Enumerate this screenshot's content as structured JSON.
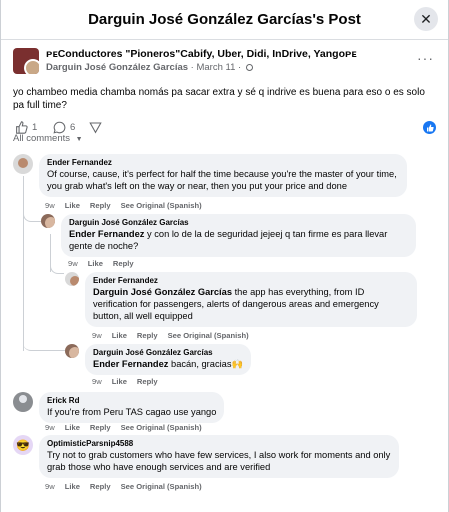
{
  "dialog": {
    "title": "Darguin José González Garcías's Post",
    "close_icon": "close-icon"
  },
  "post": {
    "group_name": "ᴘᴇConductores \"Pioneros\"Cabify, Uber, Didi, InDrive, Yangoᴘᴇ",
    "author": "Darguin José González Garcías",
    "date": "March 11",
    "separator": "·",
    "text": "yo chambeo media chamba nomás pa sacar extra y sé q indrive es buena para eso o es solo pa full time?",
    "like_count": "1",
    "comment_count": "6",
    "more_label": "···"
  },
  "comments_filter": "All comments",
  "comments": [
    {
      "name": "Ender Fernandez",
      "text": "Of course, cause, it's perfect for half the time because you're the master of your time, you grab what's left on the way or near, then you put your price and done",
      "time": "9w",
      "like": "Like",
      "reply": "Reply",
      "see_original": "See Original (Spanish)"
    },
    {
      "name": "Darguin José González Garcías",
      "mention": "Ender Fernandez",
      "text": " y con lo de la de seguridad jejeej q tan firme es para llevar gente de noche?",
      "time": "9w",
      "like": "Like",
      "reply": "Reply"
    },
    {
      "name": "Ender Fernandez",
      "mention": "Darguin José González Garcías",
      "text": " the app has everything, from ID verification for passengers, alerts of dangerous areas and emergency button, all well equipped",
      "time": "9w",
      "like": "Like",
      "reply": "Reply",
      "see_original": "See Original (Spanish)"
    },
    {
      "name": "Darguin José González Garcías",
      "mention": "Ender Fernandez",
      "text": " bacán, gracias🙌",
      "time": "9w",
      "like": "Like",
      "reply": "Reply"
    },
    {
      "name": "Erick Rd",
      "text": "If you're from Peru TAS cagao use yango",
      "time": "9w",
      "like": "Like",
      "reply": "Reply",
      "see_original": "See Original (Spanish)"
    },
    {
      "name": "OptimisticParsnip4588",
      "text": "Try not to grab customers who have few services, I also work for moments and only grab those who have enough services and are verified",
      "time": "9w",
      "like": "Like",
      "reply": "Reply",
      "see_original": "See Original (Spanish)"
    }
  ],
  "colors": {
    "accent": "#1877f2",
    "bubble": "#f0f2f5",
    "muted": "#65676b"
  }
}
